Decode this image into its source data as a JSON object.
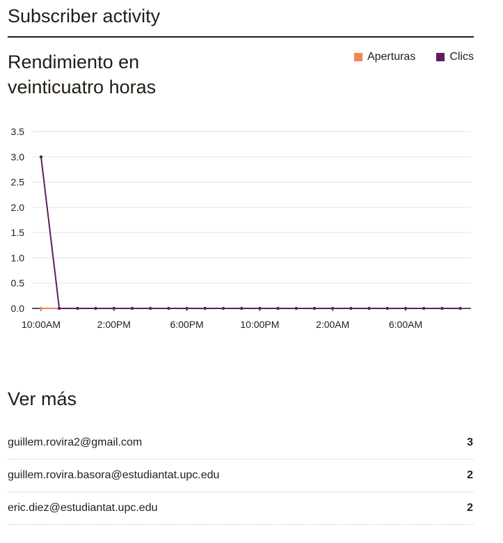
{
  "page": {
    "title": "Subscriber activity"
  },
  "chart_section": {
    "title": "Rendimiento en veinticuatro horas"
  },
  "legend": [
    {
      "label": "Aperturas",
      "color": "#ef8656"
    },
    {
      "label": "Clics",
      "color": "#5b1d5e"
    }
  ],
  "chart_data": {
    "type": "line",
    "title": "Rendimiento en veinticuatro horas",
    "xlabel": "",
    "ylabel": "",
    "x": [
      "10:00AM",
      "11:00AM",
      "12:00PM",
      "1:00PM",
      "2:00PM",
      "3:00PM",
      "4:00PM",
      "5:00PM",
      "6:00PM",
      "7:00PM",
      "8:00PM",
      "9:00PM",
      "10:00PM",
      "11:00PM",
      "12:00AM",
      "1:00AM",
      "2:00AM",
      "3:00AM",
      "4:00AM",
      "5:00AM",
      "6:00AM",
      "7:00AM",
      "8:00AM",
      "9:00AM"
    ],
    "xtick_labels": [
      "10:00AM",
      "2:00PM",
      "6:00PM",
      "10:00PM",
      "2:00AM",
      "6:00AM"
    ],
    "xtick_labels_every": 4,
    "yticks": [
      0.0,
      0.5,
      1.0,
      1.5,
      2.0,
      2.5,
      3.0,
      3.5
    ],
    "ylim": [
      0,
      3.5
    ],
    "grid": true,
    "legend_position": "top-right",
    "series": [
      {
        "name": "Aperturas",
        "color": "#ef8656",
        "values": [
          0,
          0,
          0,
          0,
          0,
          0,
          0,
          0,
          0,
          0,
          0,
          0,
          0,
          0,
          0,
          0,
          0,
          0,
          0,
          0,
          0,
          0,
          0,
          0
        ]
      },
      {
        "name": "Clics",
        "color": "#5b1d5e",
        "values": [
          3,
          0,
          0,
          0,
          0,
          0,
          0,
          0,
          0,
          0,
          0,
          0,
          0,
          0,
          0,
          0,
          0,
          0,
          0,
          0,
          0,
          0,
          0,
          0
        ]
      }
    ]
  },
  "more_section": {
    "title": "Ver más",
    "rows": [
      {
        "email": "guillem.rovira2@gmail.com",
        "count": "3"
      },
      {
        "email": "guillem.rovira.basora@estudiantat.upc.edu",
        "count": "2"
      },
      {
        "email": "eric.diez@estudiantat.upc.edu",
        "count": "2"
      }
    ]
  }
}
